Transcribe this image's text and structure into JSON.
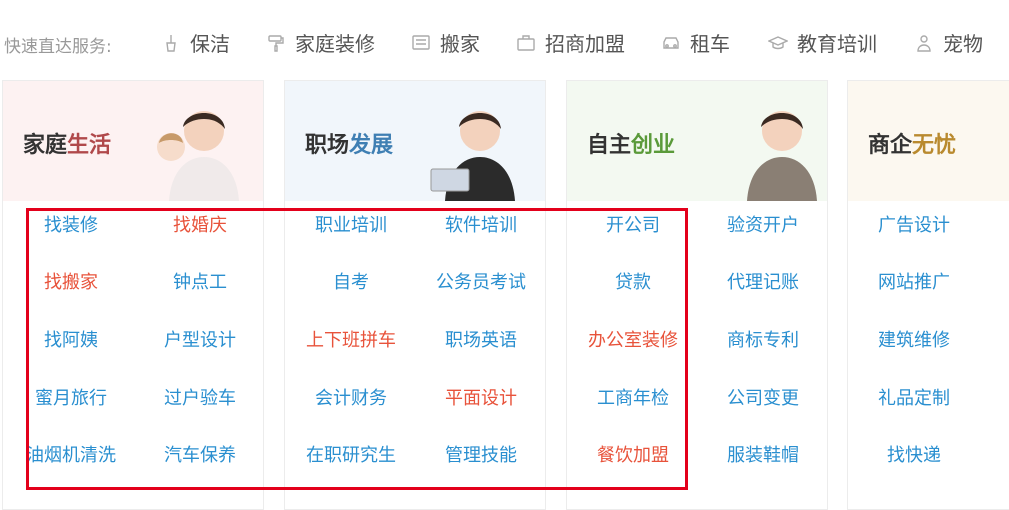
{
  "quick": {
    "label": "快速直达服务:",
    "items": [
      {
        "label": "保洁",
        "icon": "broom-icon"
      },
      {
        "label": "家庭装修",
        "icon": "paint-roller-icon"
      },
      {
        "label": "搬家",
        "icon": "moving-truck-icon"
      },
      {
        "label": "招商加盟",
        "icon": "briefcase-icon"
      },
      {
        "label": "租车",
        "icon": "car-icon"
      },
      {
        "label": "教育培训",
        "icon": "graduation-cap-icon"
      },
      {
        "label": "宠物",
        "icon": "pet-icon"
      }
    ]
  },
  "columns": [
    {
      "title_dark": "家庭",
      "title_accent": "生活",
      "accent_color": "#b0494b",
      "banner_color": "#fdf2f2",
      "items": [
        [
          {
            "label": "找装修",
            "color": "blue"
          },
          {
            "label": "找婚庆",
            "color": "red"
          }
        ],
        [
          {
            "label": "找搬家",
            "color": "red"
          },
          {
            "label": "钟点工",
            "color": "blue"
          }
        ],
        [
          {
            "label": "找阿姨",
            "color": "blue"
          },
          {
            "label": "户型设计",
            "color": "blue"
          }
        ],
        [
          {
            "label": "蜜月旅行",
            "color": "blue"
          },
          {
            "label": "过户验车",
            "color": "blue"
          }
        ],
        [
          {
            "label": "油烟机清洗",
            "color": "blue"
          },
          {
            "label": "汽车保养",
            "color": "blue"
          }
        ]
      ]
    },
    {
      "title_dark": "职场",
      "title_accent": "发展",
      "accent_color": "#3f7fb3",
      "banner_color": "#f1f6fb",
      "items": [
        [
          {
            "label": "职业培训",
            "color": "blue"
          },
          {
            "label": "软件培训",
            "color": "blue"
          }
        ],
        [
          {
            "label": "自考",
            "color": "blue"
          },
          {
            "label": "公务员考试",
            "color": "blue"
          }
        ],
        [
          {
            "label": "上下班拼车",
            "color": "red"
          },
          {
            "label": "职场英语",
            "color": "blue"
          }
        ],
        [
          {
            "label": "会计财务",
            "color": "blue"
          },
          {
            "label": "平面设计",
            "color": "red"
          }
        ],
        [
          {
            "label": "在职研究生",
            "color": "blue"
          },
          {
            "label": "管理技能",
            "color": "blue"
          }
        ]
      ]
    },
    {
      "title_dark": "自主",
      "title_accent": "创业",
      "accent_color": "#5a9a3a",
      "banner_color": "#f3f9f1",
      "items": [
        [
          {
            "label": "开公司",
            "color": "blue"
          },
          {
            "label": "验资开户",
            "color": "blue"
          }
        ],
        [
          {
            "label": "贷款",
            "color": "blue"
          },
          {
            "label": "代理记账",
            "color": "blue"
          }
        ],
        [
          {
            "label": "办公室装修",
            "color": "red"
          },
          {
            "label": "商标专利",
            "color": "blue"
          }
        ],
        [
          {
            "label": "工商年检",
            "color": "blue"
          },
          {
            "label": "公司变更",
            "color": "blue"
          }
        ],
        [
          {
            "label": "餐饮加盟",
            "color": "red"
          },
          {
            "label": "服装鞋帽",
            "color": "blue"
          }
        ]
      ]
    },
    {
      "title_dark": "商企",
      "title_accent": "无忧",
      "accent_color": "#b98a2f",
      "banner_color": "#fcf8f0",
      "items": [
        [
          {
            "label": "广告设计",
            "color": "blue"
          }
        ],
        [
          {
            "label": "网站推广",
            "color": "blue"
          }
        ],
        [
          {
            "label": "建筑维修",
            "color": "blue"
          }
        ],
        [
          {
            "label": "礼品定制",
            "color": "blue"
          }
        ],
        [
          {
            "label": "找快递",
            "color": "blue"
          }
        ]
      ]
    }
  ]
}
